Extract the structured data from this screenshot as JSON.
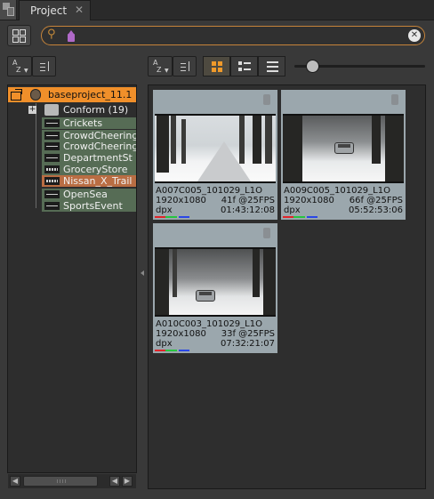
{
  "tabbar": {
    "tab_label": "Project",
    "close_glyph": "✕"
  },
  "search": {
    "value": "",
    "placeholder": "",
    "clear_glyph": "✕"
  },
  "sort": {
    "az_top": "A",
    "az_bottom": "Z"
  },
  "tree": {
    "root_label": "baseproject_11.1",
    "conform_label": "Conform (19)",
    "items": [
      {
        "label": "Crickets",
        "icon": "audio-clip-icon"
      },
      {
        "label": "CrowdCheering",
        "icon": "audio-clip-icon"
      },
      {
        "label": "CrowdCheering",
        "icon": "audio-clip-icon"
      },
      {
        "label": "DepartmentSt",
        "icon": "audio-clip-icon"
      },
      {
        "label": "GroceryStore",
        "icon": "audio-clip-icon"
      },
      {
        "label": "Nissan_X_Trail",
        "icon": "sequence-icon"
      },
      {
        "label": "OpenSea",
        "icon": "audio-clip-icon"
      },
      {
        "label": "SportsEvent",
        "icon": "audio-clip-icon"
      }
    ]
  },
  "zoom": {
    "level": 0.1
  },
  "clips": [
    {
      "name": "A007C005_101029_L1O",
      "resolution": "1920x1080",
      "frames": "41f @25FPS",
      "format": "dpx",
      "timecode": "01:43:12:08"
    },
    {
      "name": "A009C005_101029_L1O",
      "resolution": "1920x1080",
      "frames": "66f @25FPS",
      "format": "dpx",
      "timecode": "05:52:53:06"
    },
    {
      "name": "A010C003_101029_L1O",
      "resolution": "1920x1080",
      "frames": "33f @25FPS",
      "format": "dpx",
      "timecode": "07:32:21:07"
    }
  ],
  "colors": {
    "accent": "#f08f2a",
    "selected_item": "#b96d43",
    "clip_item": "#566c55",
    "search_border": "#c6843a"
  }
}
